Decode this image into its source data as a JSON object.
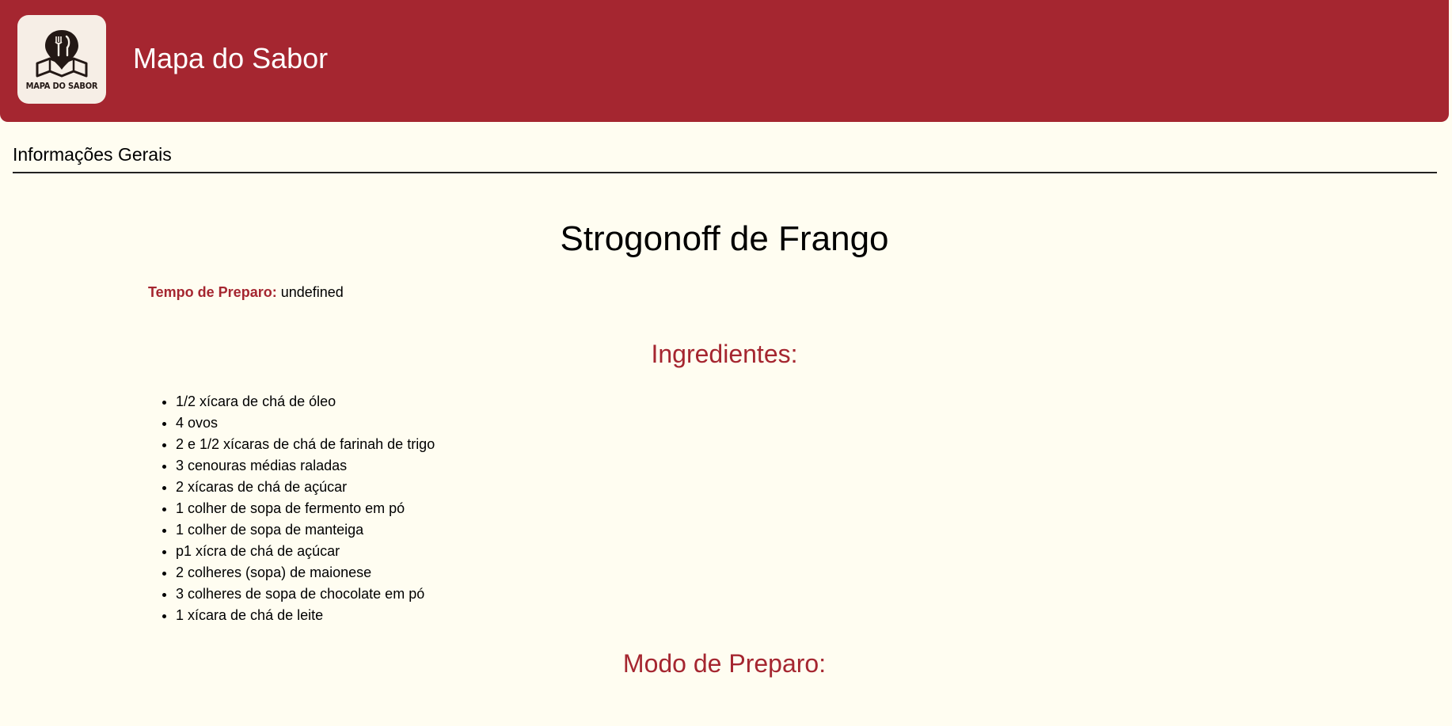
{
  "header": {
    "app_title": "Mapa do Sabor",
    "logo_text": "MAPA DO SABOR",
    "brand_color": "#a52630"
  },
  "section": {
    "heading": "Informações Gerais"
  },
  "recipe": {
    "title": "Strogonoff de Frango",
    "prep_time_label": "Tempo de Preparo:",
    "prep_time_value": "undefined",
    "ingredients_heading": "Ingredientes:",
    "ingredients": [
      "1/2 xícara de chá de óleo",
      "4 ovos",
      "2 e 1/2 xícaras de chá de farinah de trigo",
      "3 cenouras médias raladas",
      "2 xícaras de chá de açúcar",
      "1 colher de sopa de fermento em pó",
      "1 colher de sopa de manteiga",
      "p1 xícra de chá de açúcar",
      "2 colheres (sopa) de maionese",
      "3 colheres de sopa de chocolate em pó",
      "1 xícara de chá de leite"
    ],
    "method_heading": "Modo de Preparo:"
  }
}
